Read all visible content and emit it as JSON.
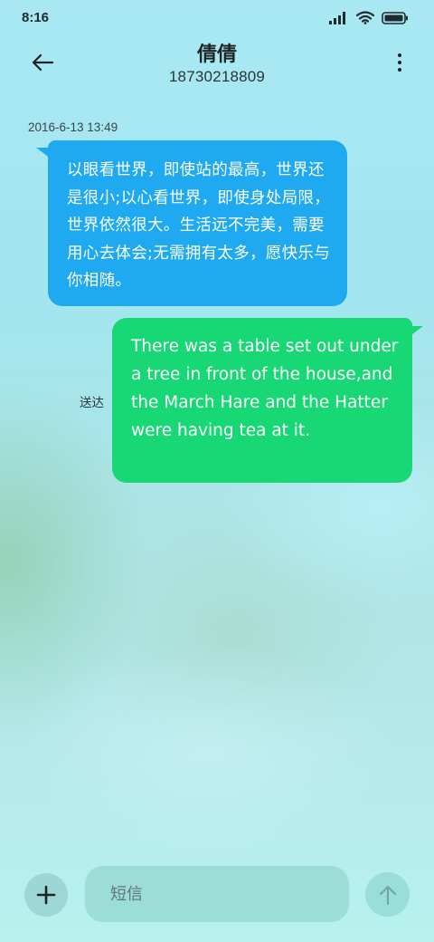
{
  "status_bar": {
    "time": "8:16"
  },
  "header": {
    "contact_name": "倩倩",
    "contact_number": "18730218809",
    "back_icon": "back-arrow-icon",
    "more_icon": "more-vertical-icon"
  },
  "conversation": {
    "timestamp": "2016-6-13 13:49",
    "incoming": {
      "text": "以眼看世界，即使站的最高，世界还是很小;以心看世界，即使身处局限，世界依然很大。生活远不完美，需要用心去体会;无需拥有太多，愿快乐与你相随。"
    },
    "outgoing": {
      "text": "There was a table set out under a tree in front of the house,and the March Hare and the Hatter were having tea at it.",
      "status": "送达"
    }
  },
  "composer": {
    "placeholder": "短信",
    "add_icon": "plus-icon",
    "send_icon": "send-arrow-icon"
  },
  "colors": {
    "incoming_bubble": "#1ea9f0",
    "outgoing_bubble": "#17d874"
  }
}
